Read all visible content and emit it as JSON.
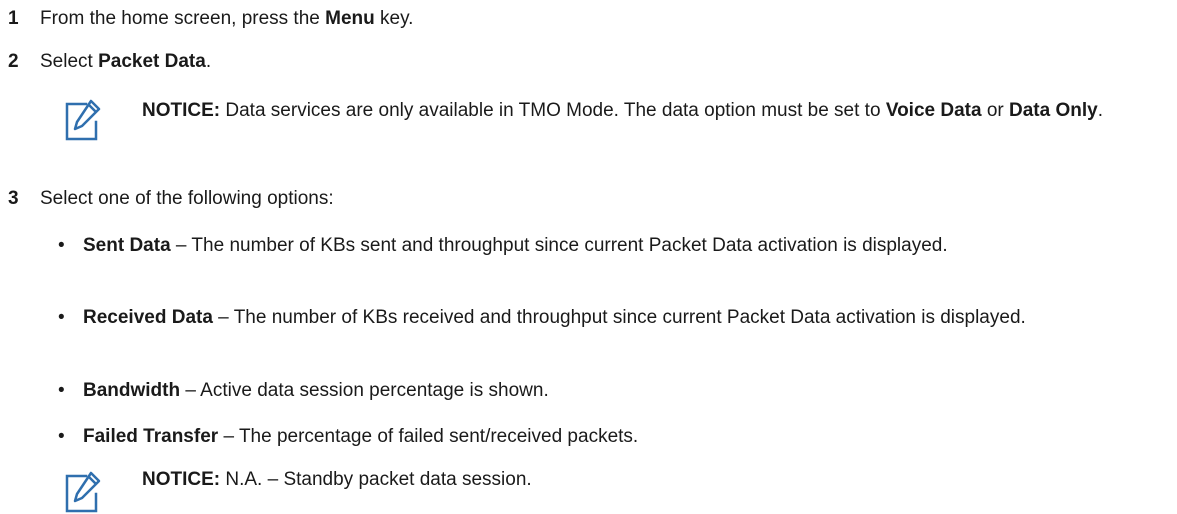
{
  "steps": [
    {
      "num": "1",
      "pre": "From the home screen, press the ",
      "bold": "Menu",
      "post": " key."
    },
    {
      "num": "2",
      "pre": "Select ",
      "bold": "Packet Data",
      "post": "."
    },
    {
      "num": "3",
      "text": "Select one of the following options:"
    }
  ],
  "notice1": {
    "label": "NOTICE:",
    "text1": " Data services are only available in TMO Mode. The data option must be set to ",
    "bold1": "Voice Data",
    "text2": " or ",
    "bold2": "Data Only",
    "text3": "."
  },
  "bullets": [
    {
      "term": "Sent Data",
      "text": " – The number of KBs sent and throughput since current Packet Data activation is displayed."
    },
    {
      "term": "Received Data",
      "text": " – The number of KBs received and throughput since current Packet Data activation is displayed."
    },
    {
      "term": "Bandwidth",
      "text": " – Active data session percentage is shown."
    },
    {
      "term": "Failed Transfer",
      "text": " – The percentage of failed sent/received packets."
    }
  ],
  "bullet_symbol": "•",
  "notice2": {
    "label": "NOTICE:",
    "text": " N.A. – Standby packet data session."
  },
  "icon_name": "notice-pencil-icon",
  "icon_color": "#2f6fae"
}
